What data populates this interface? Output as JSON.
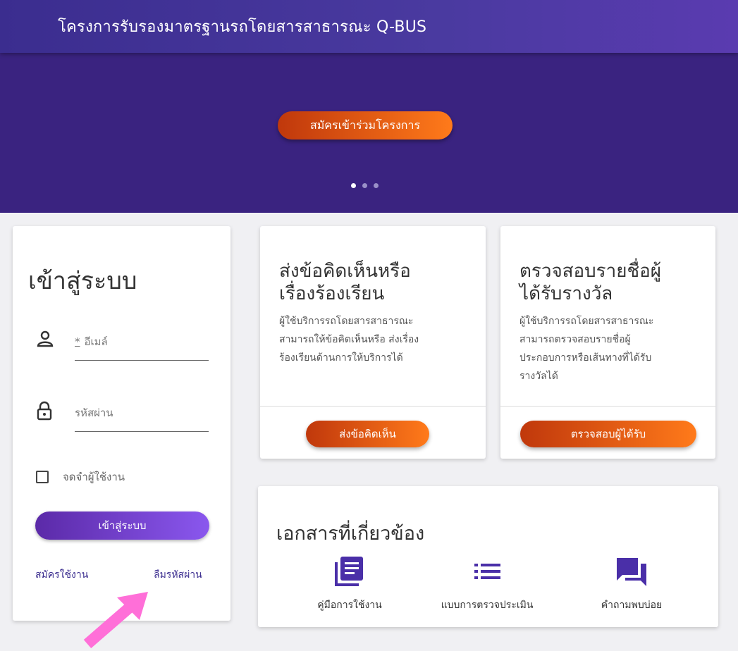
{
  "header": {
    "title": "โครงการรับรองมาตรฐานรถโดยสารสาธารณะ Q-BUS"
  },
  "hero": {
    "button_label": "สมัครเข้าร่วมโครงการ",
    "slides": 3,
    "active_slide": 1
  },
  "login": {
    "title": "เข้าสู่ระบบ",
    "email": {
      "required_mark": "*",
      "placeholder": "อีเมล์"
    },
    "password": {
      "placeholder": "รหัสผ่าน"
    },
    "remember_label": "จดจำผู้ใช้งาน",
    "submit_label": "เข้าสู่ระบบ",
    "register_label": "สมัครใช้งาน",
    "forgot_label": "ลืมรหัสผ่าน"
  },
  "feedback_card": {
    "title_line1": "ส่งข้อคิดเห็นหรือ",
    "title_line2": "เรื่องร้องเรียน",
    "desc_line1": "ผู้ใช้บริการรถโดยสารสาธารณะ",
    "desc_line2": "สามารถให้ข้อคิดเห็นหรือ ส่งเรื่อง",
    "desc_line3": "ร้องเรียนด้านการให้บริการได้",
    "button_label": "ส่งข้อคิดเห็น"
  },
  "award_card": {
    "title_line1": "ตรวจสอบรายชื่อผู้",
    "title_line2": "ได้รับรางวัล",
    "desc_line1": "ผู้ใช้บริการรถโดยสารสาธารณะ",
    "desc_line2": "สามารถตรวจสอบรายชื่อผู้",
    "desc_line3": "ประกอบการหรือเส้นทางที่ได้รับ",
    "desc_line4": "รางวัลได้",
    "button_label": "ตรวจสอบผู้ได้รับ"
  },
  "documents": {
    "title": "เอกสารที่เกี่ยวข้อง",
    "items": [
      {
        "label": "คู่มือการใช้งาน",
        "icon": "article-icon"
      },
      {
        "label": "แบบการตรวจประเมิน",
        "icon": "list-icon"
      },
      {
        "label": "คำถามพบบ่อย",
        "icon": "forum-icon"
      }
    ]
  },
  "colors": {
    "brand": "#3b2d8f",
    "hero": "#3a2380",
    "accent_orange": "#ff7a1a",
    "annotation_arrow": "#ff6fd8"
  },
  "annotation": {
    "icon": "pointer-arrow-icon"
  }
}
